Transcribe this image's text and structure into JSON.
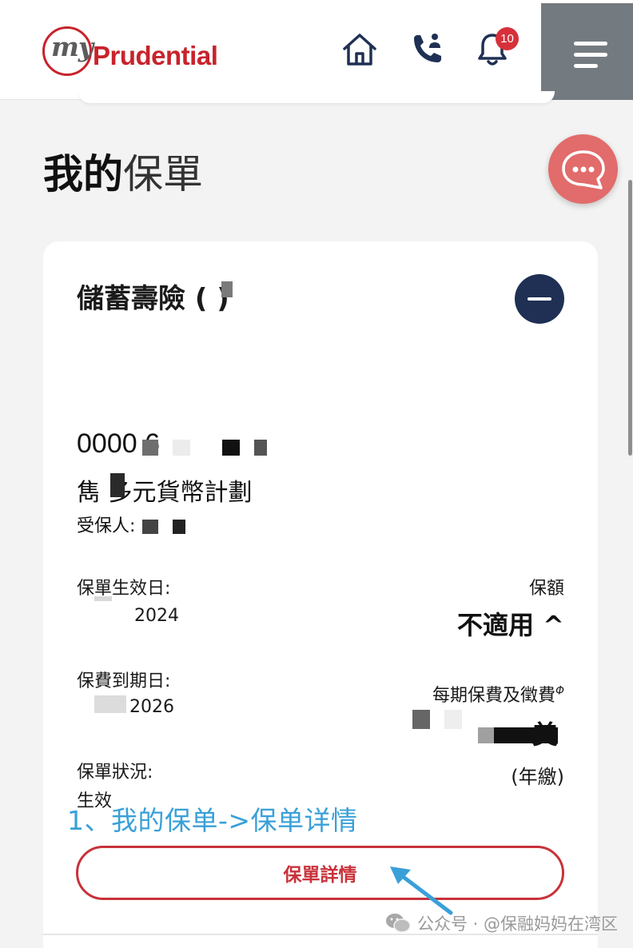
{
  "brand": {
    "logo_prefix": "my",
    "logo_name": "Prudential"
  },
  "header": {
    "notification_count": "10",
    "icons": [
      "home-icon",
      "phone-call-icon",
      "bell-icon",
      "menu-icon"
    ]
  },
  "page": {
    "title_bold": "我的",
    "title_light": "保單"
  },
  "policy": {
    "category": "儲蓄壽險 ( )",
    "number": "0000                6",
    "plan_name": "雋 多元貨幣計劃",
    "insured_label": "受保人:",
    "effective_label": "保單生效日:",
    "effective_value": "2024",
    "sum_label": "保額",
    "sum_value": "不適用 ^",
    "due_label": "保費到期日:",
    "due_value": "2026",
    "premium_label": "每期保費及徵費",
    "premium_mark": "Φ",
    "premium_value": "美",
    "premium_frequency": "(年繳)",
    "status_label": "保單狀況:",
    "status_value": "生效",
    "details_button": "保單詳情"
  },
  "annotation": {
    "text": "1、我的保单->保单详情"
  },
  "watermark": {
    "text": "公众号 · @保融妈妈在湾区"
  },
  "colors": {
    "brand_red": "#c8232c",
    "menu_gray": "#747b80",
    "collapse_navy": "#1f3054",
    "chat_red": "#e26b6b",
    "annotation_blue": "#39a0d8"
  }
}
